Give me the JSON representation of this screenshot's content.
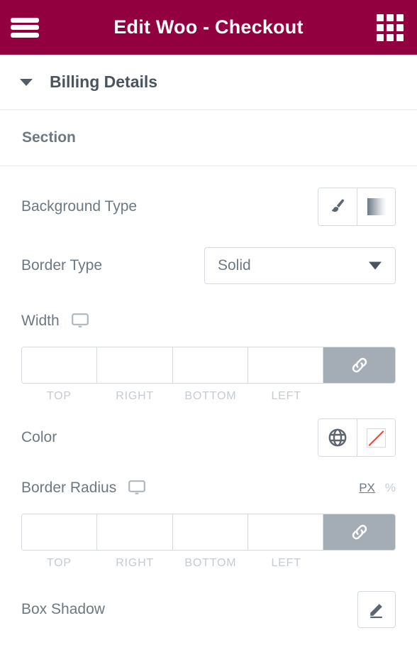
{
  "header": {
    "title": "Edit Woo - Checkout",
    "menu_icon": "hamburger-menu-icon",
    "apps_icon": "apps-grid-icon",
    "background_color": "#93003f"
  },
  "accordion": {
    "title": "Billing Details",
    "caret_icon": "caret-down-icon",
    "expanded": true
  },
  "section": {
    "label": "Section"
  },
  "controls": {
    "background_type": {
      "label": "Background Type",
      "options": [
        {
          "name": "classic",
          "icon": "paint-brush-icon"
        },
        {
          "name": "gradient",
          "icon": "gradient-swatch-icon"
        }
      ]
    },
    "border_type": {
      "label": "Border Type",
      "value": "Solid",
      "caret_icon": "chevron-down-icon"
    },
    "width": {
      "label": "Width",
      "device_icon": "desktop-monitor-icon",
      "values": [
        "",
        "",
        "",
        ""
      ],
      "sub_labels": [
        "TOP",
        "RIGHT",
        "BOTTOM",
        "LEFT"
      ],
      "link_icon": "link-icon",
      "linked": true
    },
    "color": {
      "label": "Color",
      "globe_icon": "globe-icon",
      "swatch_icon": "no-color-swatch-icon",
      "swatch_value": "none",
      "slash_color": "#f44336"
    },
    "border_radius": {
      "label": "Border Radius",
      "device_icon": "desktop-monitor-icon",
      "units": [
        "PX",
        "%"
      ],
      "active_unit": "PX",
      "values": [
        "",
        "",
        "",
        ""
      ],
      "sub_labels": [
        "TOP",
        "RIGHT",
        "BOTTOM",
        "LEFT"
      ],
      "link_icon": "link-icon",
      "linked": true
    },
    "box_shadow": {
      "label": "Box Shadow",
      "edit_icon": "pencil-edit-icon"
    }
  }
}
